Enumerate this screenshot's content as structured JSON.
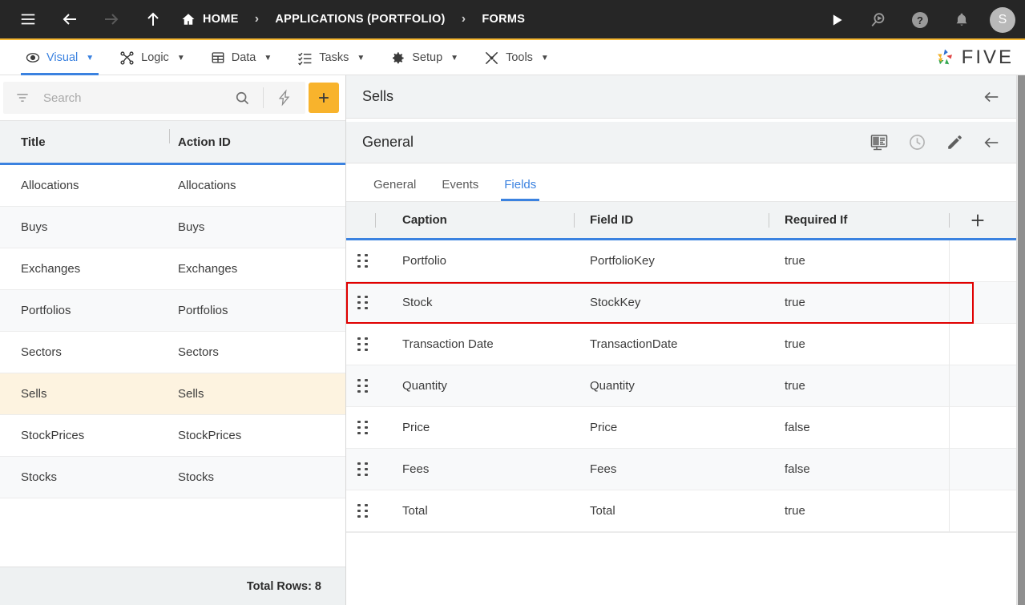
{
  "topbar": {
    "menu_icon": "hamburger-icon",
    "back_icon": "arrow-left-icon",
    "forward_icon": "arrow-right-icon",
    "up_icon": "arrow-up-icon",
    "breadcrumb": [
      {
        "label": "HOME",
        "icon": "home-icon"
      },
      {
        "label": "APPLICATIONS (PORTFOLIO)",
        "icon": ""
      },
      {
        "label": "FORMS",
        "icon": ""
      }
    ],
    "separator": "›",
    "actions": [
      {
        "name": "run-icon"
      },
      {
        "name": "search-run-icon"
      },
      {
        "name": "help-icon"
      },
      {
        "name": "notifications-bell-icon"
      }
    ],
    "avatar_initial": "S",
    "accent_color": "#f5b731",
    "background": "#262626"
  },
  "menubar": {
    "items": [
      {
        "label": "Visual",
        "icon": "eye-icon",
        "active": true
      },
      {
        "label": "Logic",
        "icon": "logic-nodes-icon",
        "active": false
      },
      {
        "label": "Data",
        "icon": "table-grid-icon",
        "active": false
      },
      {
        "label": "Tasks",
        "icon": "task-list-icon",
        "active": false
      },
      {
        "label": "Setup",
        "icon": "gear-icon",
        "active": false
      },
      {
        "label": "Tools",
        "icon": "tools-wrench-icon",
        "active": false
      }
    ],
    "caret": "▼",
    "brand": "FIVE",
    "active_color": "#3b82e0"
  },
  "sidebar": {
    "search": {
      "placeholder": "Search",
      "value": "",
      "filter_icon": "filter-icon",
      "search_icon": "search-icon",
      "lightning_icon": "lightning-bolt-icon",
      "add_label": "+",
      "add_color": "#f8b32c"
    },
    "table": {
      "columns": [
        "Title",
        "Action ID"
      ],
      "rows": [
        {
          "title": "Allocations",
          "action_id": "Allocations",
          "selected": false
        },
        {
          "title": "Buys",
          "action_id": "Buys",
          "selected": false
        },
        {
          "title": "Exchanges",
          "action_id": "Exchanges",
          "selected": false
        },
        {
          "title": "Portfolios",
          "action_id": "Portfolios",
          "selected": false
        },
        {
          "title": "Sectors",
          "action_id": "Sectors",
          "selected": false
        },
        {
          "title": "Sells",
          "action_id": "Sells",
          "selected": true
        },
        {
          "title": "StockPrices",
          "action_id": "StockPrices",
          "selected": false
        },
        {
          "title": "Stocks",
          "action_id": "Stocks",
          "selected": false
        }
      ]
    },
    "footer": {
      "total_rows_label": "Total Rows: 8"
    }
  },
  "detail": {
    "title": "Sells",
    "title_back_icon": "arrow-left-icon",
    "section_title": "General",
    "section_actions": [
      {
        "name": "form-designer-icon"
      },
      {
        "name": "history-clock-icon"
      },
      {
        "name": "edit-pencil-icon"
      },
      {
        "name": "arrow-left-icon"
      }
    ],
    "tabs": [
      {
        "label": "General",
        "active": false
      },
      {
        "label": "Events",
        "active": false
      },
      {
        "label": "Fields",
        "active": true
      }
    ],
    "fields_table": {
      "columns": [
        "Caption",
        "Field ID",
        "Required If"
      ],
      "add_label": "+",
      "drag_handle_icon": "drag-handle-icon",
      "rows": [
        {
          "caption": "Portfolio",
          "field_id": "PortfolioKey",
          "required_if": "true",
          "highlighted": false
        },
        {
          "caption": "Stock",
          "field_id": "StockKey",
          "required_if": "true",
          "highlighted": true
        },
        {
          "caption": "Transaction Date",
          "field_id": "TransactionDate",
          "required_if": "true",
          "highlighted": false
        },
        {
          "caption": "Quantity",
          "field_id": "Quantity",
          "required_if": "true",
          "highlighted": false
        },
        {
          "caption": "Price",
          "field_id": "Price",
          "required_if": "false",
          "highlighted": false
        },
        {
          "caption": "Fees",
          "field_id": "Fees",
          "required_if": "false",
          "highlighted": false
        },
        {
          "caption": "Total",
          "field_id": "Total",
          "required_if": "true",
          "highlighted": false
        }
      ],
      "highlight_color": "#e00000"
    }
  }
}
